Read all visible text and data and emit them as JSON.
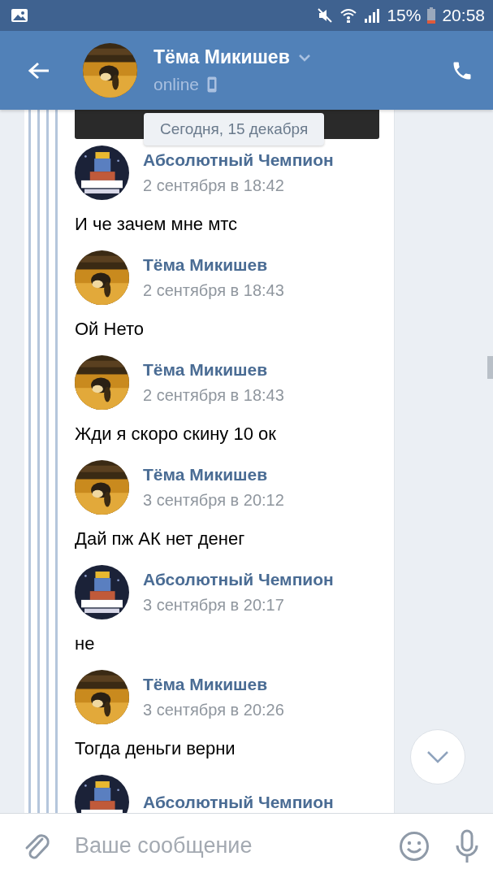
{
  "status_bar": {
    "battery": "15%",
    "time": "20:58"
  },
  "header": {
    "title": "Тёма Микишев",
    "subtitle": "online"
  },
  "date_badge": "Сегодня, 15 декабря",
  "messages": [
    {
      "kind": "emblem",
      "sender": "Абсолютный Чемпион",
      "time": "2 сентября в 18:42",
      "text": "И че зачем мне мтс"
    },
    {
      "sender": "Тёма Микишев",
      "time": "2 сентября в 18:43",
      "text": "Ой Нето"
    },
    {
      "sender": "Тёма Микишев",
      "time": "2 сентября в 18:43",
      "text": "Жди я скоро скину 10 ок"
    },
    {
      "sender": "Тёма Микишев",
      "time": "3 сентября в 20:12",
      "text": "Дай пж АК нет денег"
    },
    {
      "kind": "emblem",
      "sender": "Абсолютный Чемпион",
      "time": "3 сентября в 20:17",
      "text": "не"
    },
    {
      "sender": "Тёма Микишев",
      "time": "3 сентября в 20:26",
      "text": "Тогда деньги верни"
    },
    {
      "kind": "emblem",
      "sender": "Абсолютный Чемпион"
    }
  ],
  "composer": {
    "placeholder": "Ваше сообщение"
  }
}
